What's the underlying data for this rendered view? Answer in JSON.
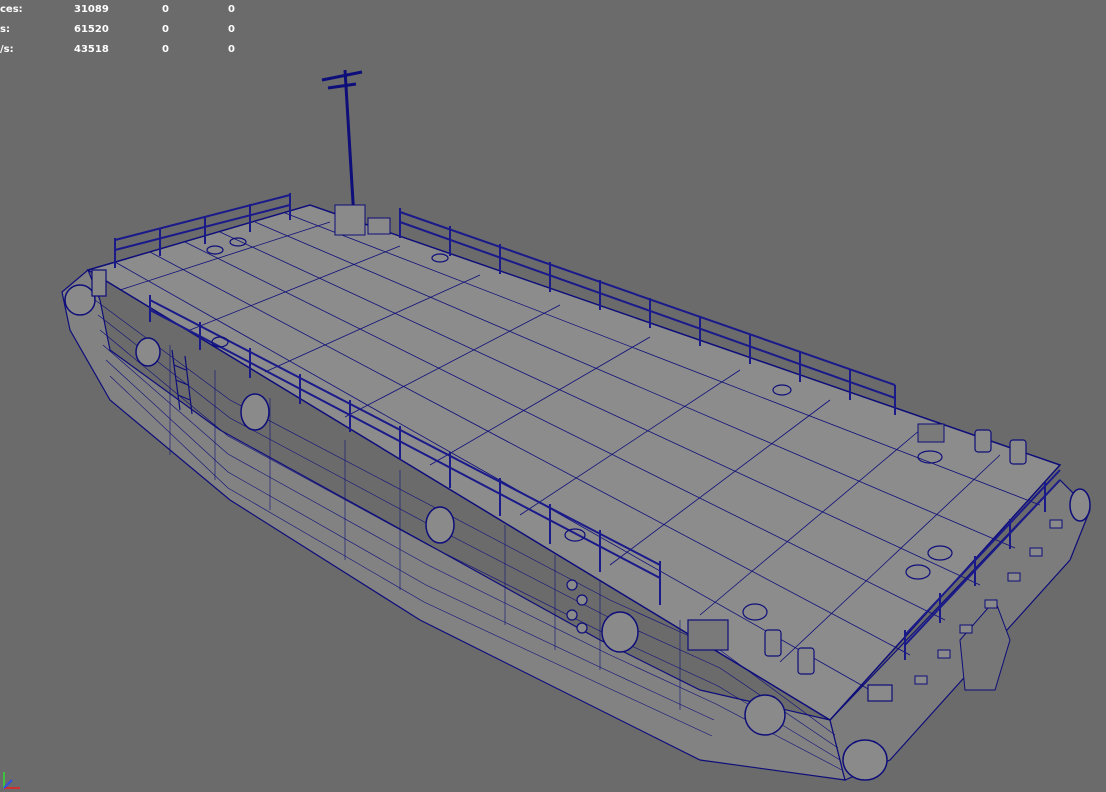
{
  "hud": {
    "rows": [
      {
        "label": "ces:",
        "values": [
          "31089",
          "0",
          "0"
        ]
      },
      {
        "label": "s:",
        "values": [
          "61520",
          "0",
          "0"
        ]
      },
      {
        "label": "/s:",
        "values": [
          "43518",
          "0",
          "0"
        ]
      }
    ]
  },
  "colors": {
    "background": "#6b6b6b",
    "mesh_fill": "#8c8c8c",
    "wireframe": "#0e0e7a",
    "hud_text": "#ffffff"
  },
  "icons": {
    "axis_gizmo": "axis-gizmo-icon"
  }
}
